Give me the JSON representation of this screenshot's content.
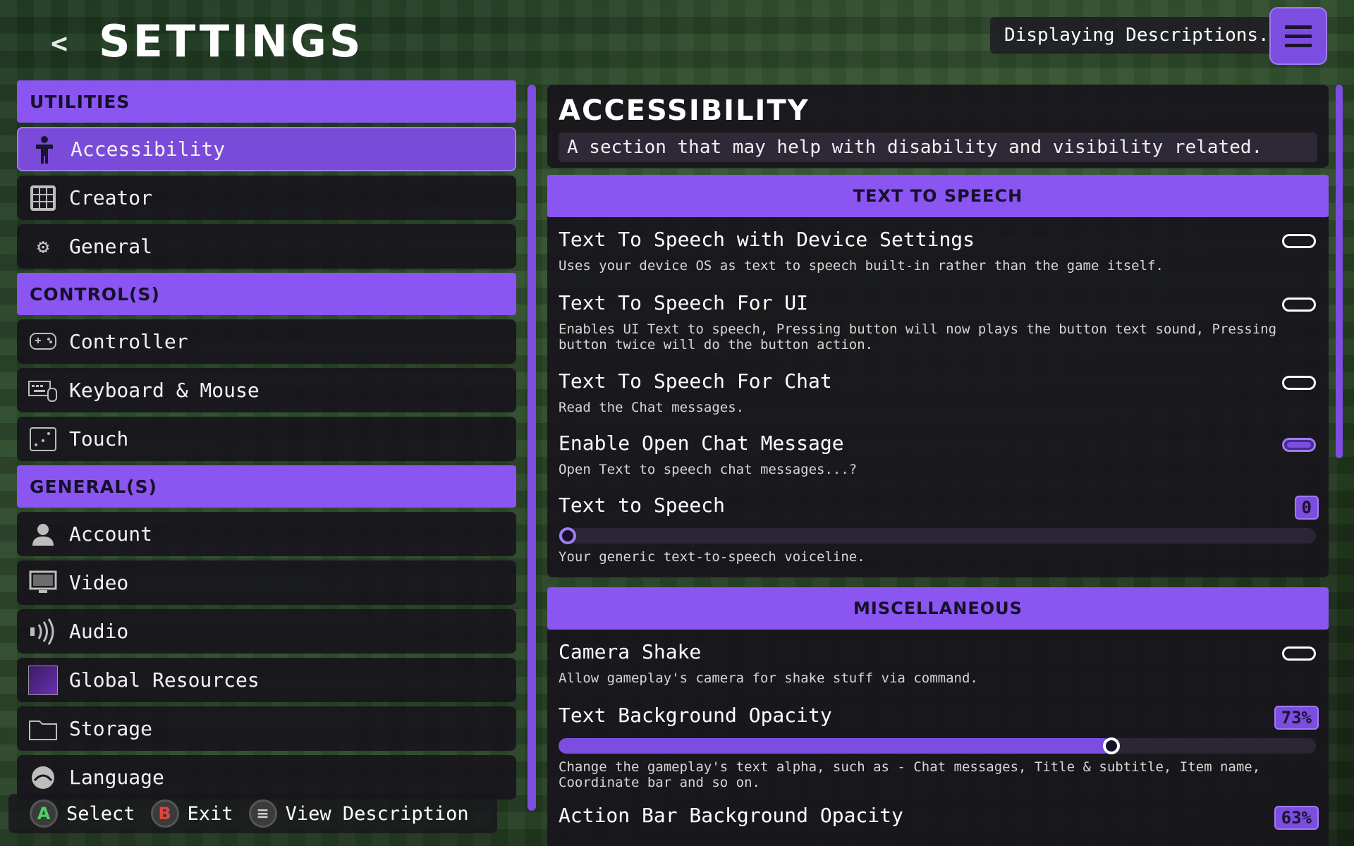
{
  "header": {
    "title": "SETTINGS",
    "descriptions_toggle": "Displaying Descriptions."
  },
  "sidebar": {
    "sections": [
      {
        "title": "UTILITIES",
        "items": [
          {
            "label": "Accessibility",
            "icon": "person-icon",
            "active": true
          },
          {
            "label": "Creator",
            "icon": "grid-icon"
          },
          {
            "label": "General",
            "icon": "gear-icon"
          }
        ]
      },
      {
        "title": "CONTROL(S)",
        "items": [
          {
            "label": "Controller",
            "icon": "gamepad-icon"
          },
          {
            "label": "Keyboard & Mouse",
            "icon": "keyboard-mouse-icon"
          },
          {
            "label": "Touch",
            "icon": "touch-icon"
          }
        ]
      },
      {
        "title": "GENERAL(S)",
        "items": [
          {
            "label": "Account",
            "icon": "user-icon"
          },
          {
            "label": "Video",
            "icon": "monitor-icon"
          },
          {
            "label": "Audio",
            "icon": "speaker-icon"
          },
          {
            "label": "Global Resources",
            "icon": "resource-pack-icon"
          },
          {
            "label": "Storage",
            "icon": "folder-icon"
          },
          {
            "label": "Language",
            "icon": "globe-icon"
          }
        ]
      }
    ]
  },
  "panel": {
    "title": "ACCESSIBILITY",
    "description": "A section that may help with disability and visibility related.",
    "groups": [
      {
        "title": "TEXT TO SPEECH",
        "settings": [
          {
            "label": "Text To Speech with Device Settings",
            "desc": "Uses your device OS as text to speech built-in rather than the game itself.",
            "type": "toggle",
            "on": false
          },
          {
            "label": "Text To Speech For UI",
            "desc": "Enables UI Text to speech, Pressing button will now plays the button text sound, Pressing button twice will do the button action.",
            "type": "toggle",
            "on": false
          },
          {
            "label": "Text To Speech For Chat",
            "desc": "Read the Chat messages.",
            "type": "toggle",
            "on": false
          },
          {
            "label": "Enable Open Chat Message",
            "desc": "Open Text to speech chat messages...?",
            "type": "toggle",
            "on": true
          },
          {
            "label": "Text to Speech",
            "desc": "Your generic text-to-speech voiceline.",
            "type": "slider",
            "value_text": "0",
            "value": 0.0
          }
        ]
      },
      {
        "title": "MISCELLANEOUS",
        "settings": [
          {
            "label": "Camera Shake",
            "desc": "Allow gameplay's camera for shake stuff via command.",
            "type": "toggle",
            "on": false
          },
          {
            "label": "Text Background Opacity",
            "desc": "Change the gameplay's text alpha, such as - Chat messages, Title & subtitle, Item name, Coordinate bar and so on.",
            "type": "slider",
            "value_text": "73%",
            "value": 0.73
          },
          {
            "label": "Action Bar Background Opacity",
            "desc": "",
            "type": "slider",
            "value_text": "63%",
            "value": 0.63
          }
        ]
      }
    ]
  },
  "footer": {
    "hints": [
      {
        "glyph": "A",
        "label": "Select"
      },
      {
        "glyph": "B",
        "label": "Exit"
      },
      {
        "glyph": "≡",
        "label": "View Description"
      }
    ]
  },
  "colors": {
    "accent": "#8a55f0",
    "accent_dark": "#7b4ee0",
    "panel_bg": "#18161c",
    "text": "#ffffff"
  }
}
